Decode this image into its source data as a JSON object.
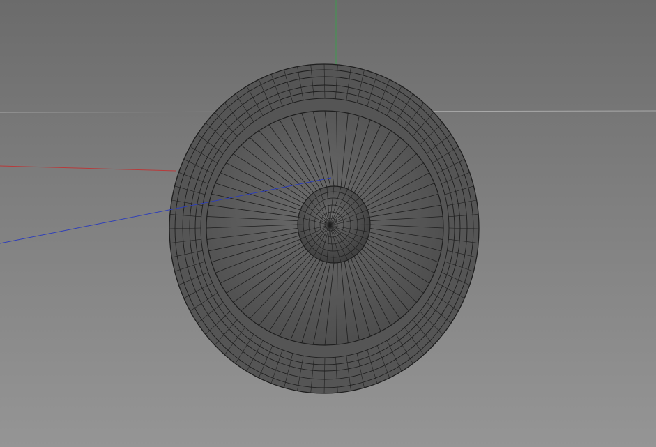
{
  "viewport": {
    "kind": "3d-modeling-viewport",
    "background_top": "#6b6b6b",
    "background_bottom": "#959595"
  },
  "axes": {
    "x_color": "#b83a3a",
    "y_color": "#3f9a4f",
    "z_color": "#2f3fb8",
    "horizon_color": "#a9a9a9"
  },
  "model": {
    "object": "speaker-cone",
    "display_mode": "shaded-wireframe",
    "surface_color": "#555555",
    "wire_color": "#1e1e1e",
    "radial_segments": 64
  }
}
